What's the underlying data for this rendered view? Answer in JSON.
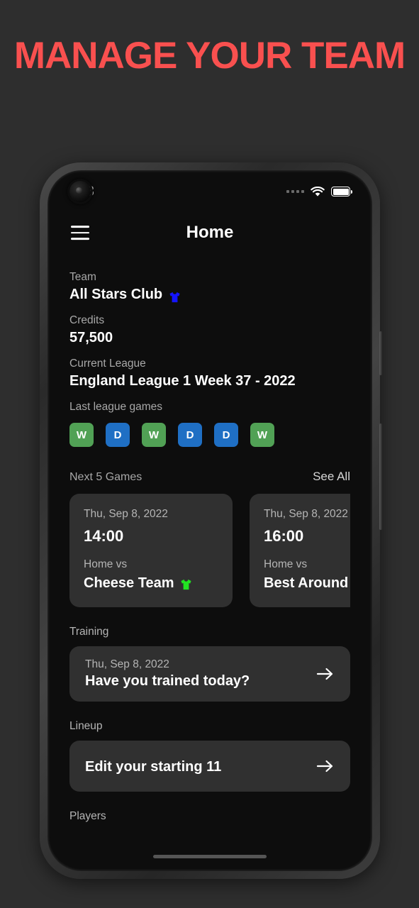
{
  "headline": "MANAGE YOUR TEAM",
  "colors": {
    "headline": "#f9504f",
    "page_background": "#2e2e2e",
    "screen_background": "#0d0d0d",
    "card_background": "#303030",
    "win": "#51a155",
    "draw": "#1f6fc4"
  },
  "status_bar": {
    "time": ".33",
    "wifi_icon": "wifi-icon",
    "battery_icon": "battery-full-icon",
    "signal_icon": "signal-dots-icon",
    "camera": "front-camera-punch-hole"
  },
  "app_bar": {
    "menu_icon": "hamburger-menu-icon",
    "title": "Home"
  },
  "team": {
    "label": "Team",
    "name": "All Stars Club",
    "badge_icon": "blue-shirt-icon",
    "badge_color": "#1414ff"
  },
  "credits": {
    "label": "Credits",
    "value": "57,500"
  },
  "league": {
    "label": "Current League",
    "value": "England League 1 Week 37 - 2022"
  },
  "last_games": {
    "label": "Last league games",
    "results": [
      {
        "code": "W",
        "type": "win"
      },
      {
        "code": "D",
        "type": "draw"
      },
      {
        "code": "W",
        "type": "win"
      },
      {
        "code": "D",
        "type": "draw"
      },
      {
        "code": "D",
        "type": "draw"
      },
      {
        "code": "W",
        "type": "win"
      }
    ]
  },
  "next_games": {
    "label": "Next 5 Games",
    "see_all": "See All",
    "cards": [
      {
        "date": "Thu, Sep 8, 2022",
        "time": "14:00",
        "venue": "Home vs",
        "opponent": "Cheese Team",
        "badge_icon": "green-shirt-icon",
        "badge_color": "#22e322"
      },
      {
        "date": "Thu, Sep 8, 2022",
        "time": "16:00",
        "venue": "Home vs",
        "opponent": "Best Around F",
        "badge_icon": "",
        "badge_color": ""
      }
    ]
  },
  "training": {
    "label": "Training",
    "date": "Thu, Sep 8, 2022",
    "title": "Have you trained today?",
    "arrow_icon": "arrow-right-icon"
  },
  "lineup": {
    "label": "Lineup",
    "title": "Edit your starting 11",
    "arrow_icon": "arrow-right-icon"
  },
  "players": {
    "label": "Players"
  }
}
